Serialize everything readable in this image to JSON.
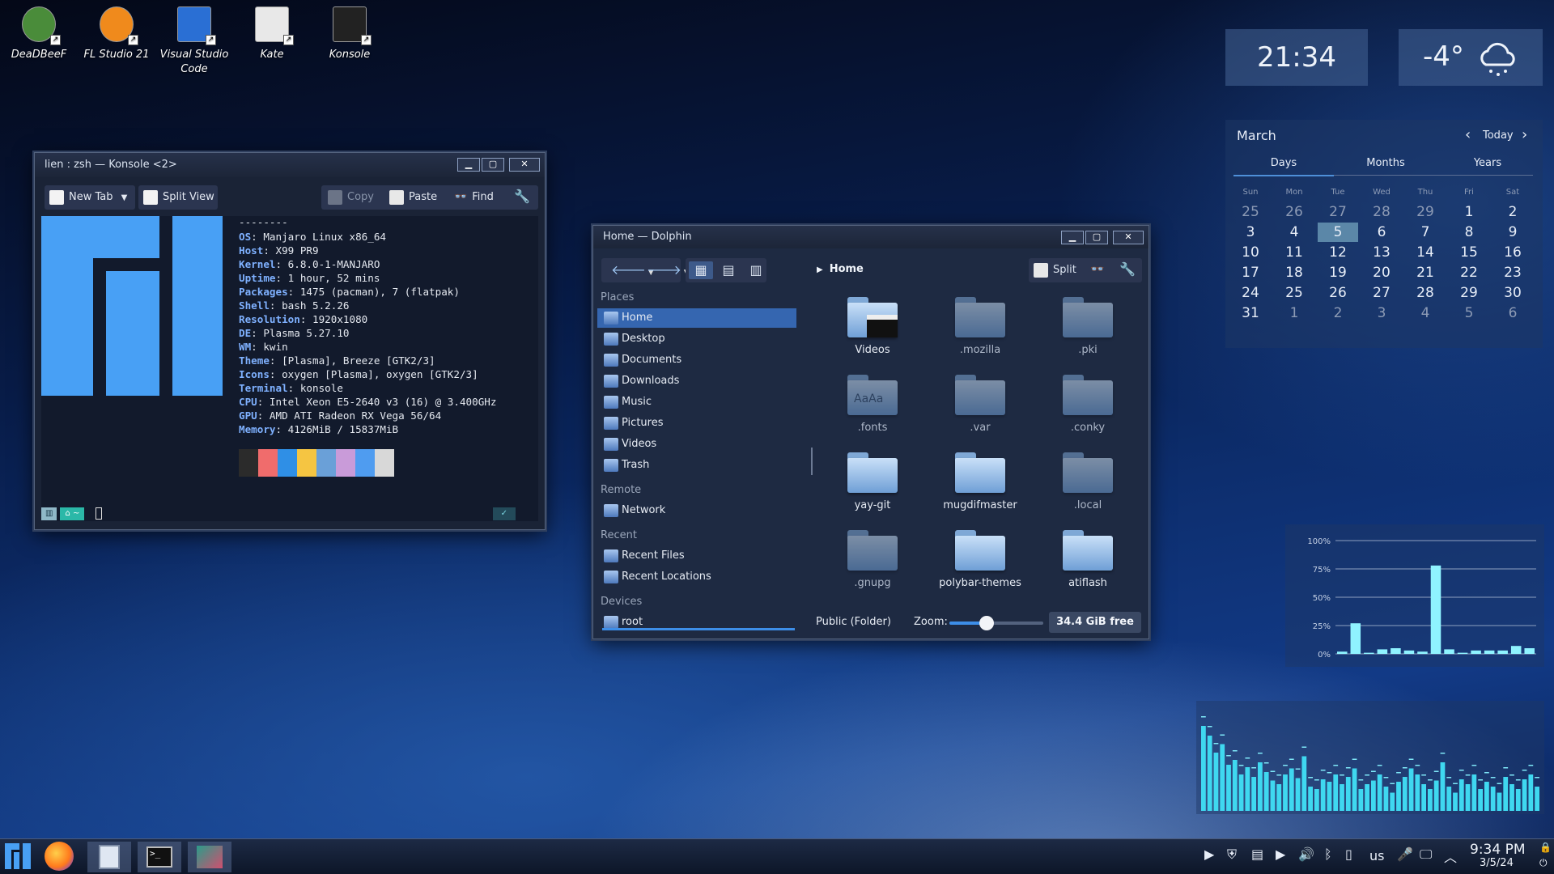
{
  "desktop_icons": [
    {
      "label": "DeaDBeeF",
      "icon": "deadbeef-icon"
    },
    {
      "label": "FL Studio 21",
      "icon": "fl-studio-icon"
    },
    {
      "label": "Visual Studio Code",
      "icon": "vscode-icon"
    },
    {
      "label": "Kate",
      "icon": "kate-icon"
    },
    {
      "label": "Konsole",
      "icon": "konsole-icon"
    }
  ],
  "konsole": {
    "title": "lien : zsh — Konsole <2>",
    "toolbar": {
      "new_tab": "New Tab",
      "split_view": "Split View",
      "copy": "Copy",
      "paste": "Paste",
      "find": "Find"
    },
    "separator": "--------",
    "info": [
      {
        "key": "OS",
        "value": ": Manjaro Linux x86_64"
      },
      {
        "key": "Host",
        "value": ": X99 PR9"
      },
      {
        "key": "Kernel",
        "value": ": 6.8.0-1-MANJARO"
      },
      {
        "key": "Uptime",
        "value": ": 1 hour, 52 mins"
      },
      {
        "key": "Packages",
        "value": ": 1475 (pacman), 7 (flatpak)"
      },
      {
        "key": "Shell",
        "value": ": bash 5.2.26"
      },
      {
        "key": "Resolution",
        "value": ": 1920x1080"
      },
      {
        "key": "DE",
        "value": ": Plasma 5.27.10"
      },
      {
        "key": "WM",
        "value": ": kwin"
      },
      {
        "key": "Theme",
        "value": ": [Plasma], Breeze [GTK2/3]"
      },
      {
        "key": "Icons",
        "value": ": oxygen [Plasma], oxygen [GTK2/3]"
      },
      {
        "key": "Terminal",
        "value": ": konsole"
      },
      {
        "key": "CPU",
        "value": ": Intel Xeon E5-2640 v3 (16) @ 3.400GHz"
      },
      {
        "key": "GPU",
        "value": ": AMD ATI Radeon RX Vega 56/64"
      },
      {
        "key": "Memory",
        "value": ": 4126MiB / 15837MiB"
      }
    ],
    "palette": [
      "#2b2b2b",
      "#f06c6c",
      "#2f8fe6",
      "#f5c542",
      "#6aa0d8",
      "#c99bd9",
      "#4f9cf0",
      "#d8d8d8"
    ],
    "prompt": {
      "home": "⌂ ~",
      "ok": "✓"
    }
  },
  "dolphin": {
    "title": "Home — Dolphin",
    "breadcrumb": "Home",
    "split_label": "Split",
    "places_header": "Places",
    "places": [
      "Home",
      "Desktop",
      "Documents",
      "Downloads",
      "Music",
      "Pictures",
      "Videos",
      "Trash"
    ],
    "remote_header": "Remote",
    "remote": [
      "Network"
    ],
    "recent_header": "Recent",
    "recent": [
      "Recent Files",
      "Recent Locations"
    ],
    "devices_header": "Devices",
    "devices": [
      "root"
    ],
    "files": [
      {
        "name": "Videos",
        "hidden": false
      },
      {
        "name": ".mozilla",
        "hidden": true
      },
      {
        "name": ".pki",
        "hidden": true
      },
      {
        "name": ".fonts",
        "hidden": true
      },
      {
        "name": ".var",
        "hidden": true
      },
      {
        "name": ".conky",
        "hidden": true
      },
      {
        "name": "yay-git",
        "hidden": false
      },
      {
        "name": "mugdifmaster",
        "hidden": false
      },
      {
        "name": ".local",
        "hidden": true
      },
      {
        "name": ".gnupg",
        "hidden": true
      },
      {
        "name": "polybar-themes",
        "hidden": false
      },
      {
        "name": "atiflash",
        "hidden": false
      }
    ],
    "status": "Public (Folder)",
    "zoom_label": "Zoom:",
    "zoom_value": 0.4,
    "free_space": "34.4 GiB free"
  },
  "clock_widget": {
    "time": "21:34"
  },
  "weather_widget": {
    "temp": "-4°",
    "icon": "snow-cloud-icon"
  },
  "calendar": {
    "month": "March",
    "today_label": "Today",
    "tabs": [
      "Days",
      "Months",
      "Years"
    ],
    "weekdays": [
      "Sun",
      "Mon",
      "Tue",
      "Wed",
      "Thu",
      "Fri",
      "Sat"
    ],
    "weeks": [
      [
        "25",
        "26",
        "27",
        "28",
        "29",
        "1",
        "2"
      ],
      [
        "3",
        "4",
        "5",
        "6",
        "7",
        "8",
        "9"
      ],
      [
        "10",
        "11",
        "12",
        "13",
        "14",
        "15",
        "16"
      ],
      [
        "17",
        "18",
        "19",
        "20",
        "21",
        "22",
        "23"
      ],
      [
        "24",
        "25",
        "26",
        "27",
        "28",
        "29",
        "30"
      ],
      [
        "31",
        "1",
        "2",
        "3",
        "4",
        "5",
        "6"
      ]
    ],
    "selected": "5"
  },
  "cpu_graph": {
    "y_ticks": [
      "100%",
      "75%",
      "50%",
      "25%",
      "0%"
    ],
    "values": [
      2,
      27,
      1,
      4,
      5,
      3,
      2,
      78,
      4,
      1,
      3,
      3,
      3,
      7,
      5
    ]
  },
  "audio_visualizer": {
    "values": [
      70,
      62,
      48,
      55,
      38,
      42,
      30,
      36,
      28,
      40,
      32,
      25,
      22,
      30,
      35,
      27,
      45,
      20,
      18,
      26,
      24,
      30,
      22,
      28,
      35,
      18,
      22,
      25,
      30,
      20,
      15,
      24,
      28,
      35,
      30,
      22,
      18,
      25,
      40,
      20,
      15,
      26,
      22,
      30,
      18,
      24,
      20,
      15,
      28,
      22,
      18,
      26,
      30,
      20
    ]
  },
  "taskbar": {
    "apps": [
      "manjaro-menu-icon",
      "firefox-icon",
      "file-manager-icon",
      "konsole-icon",
      "kate-icon"
    ],
    "tray": {
      "keyboard": "us"
    },
    "time": "9:34 PM",
    "date": "3/5/24"
  }
}
